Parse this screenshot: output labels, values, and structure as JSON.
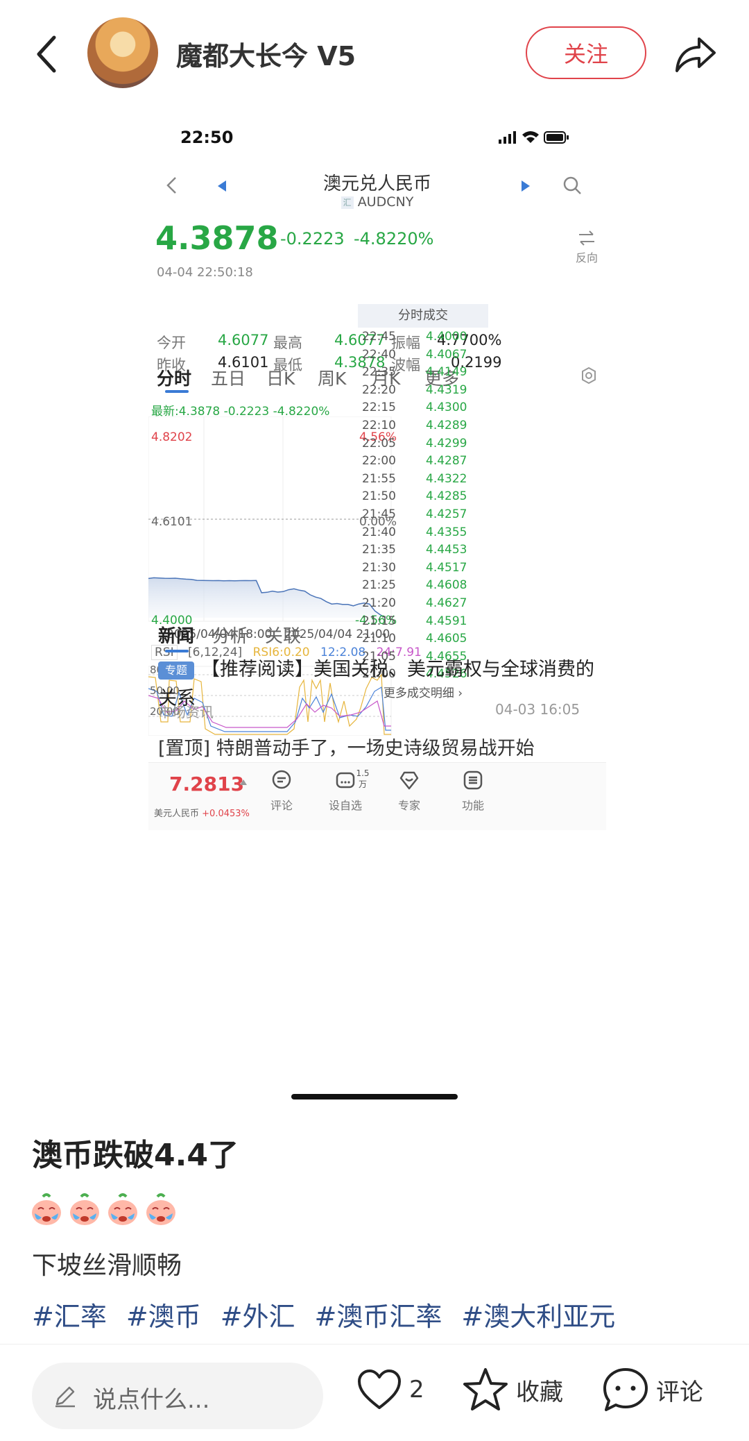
{
  "header": {
    "author_name": "魔都大长今 V5",
    "follow_label": "关注"
  },
  "screenshot": {
    "status_time": "22:50",
    "pair_name": "澳元兑人民币",
    "pair_code": "AUDCNY",
    "pair_icon_text": "汇",
    "price": "4.3878",
    "change": "-0.2223",
    "change_pct": "-4.8220%",
    "timestamp": "04-04 22:50:18",
    "reverse_label": "反向",
    "stats": {
      "open_label": "今开",
      "open": "4.6077",
      "high_label": "最高",
      "high": "4.6077",
      "amplitude_label": "振幅",
      "amplitude": "4.7700%",
      "prev_close_label": "昨收",
      "prev_close": "4.6101",
      "low_label": "最低",
      "low": "4.3878",
      "range_label": "波幅",
      "range": "0.2199"
    },
    "tabs": [
      "分时",
      "五日",
      "日K",
      "周K",
      "月K",
      "更多"
    ],
    "latest_line": "最新:4.3878  -0.2223  -4.8220%",
    "chart_labels": {
      "y_top": "4.8202",
      "y_top_pct": "4.56%",
      "y_mid": "4.6101",
      "y_mid_pct": "0.00%",
      "y_bottom": "4.4000",
      "y_bottom_pct": "-4.56%",
      "x_left": "2025/04/04 18:00",
      "x_right": "2025/04/04 21:00"
    },
    "trades_header": "分时成交",
    "trades": [
      {
        "time": "22:45",
        "price": "4.4000"
      },
      {
        "time": "22:40",
        "price": "4.4067"
      },
      {
        "time": "22:35",
        "price": "4.4149"
      },
      {
        "time": "22:20",
        "price": "4.4319"
      },
      {
        "time": "22:15",
        "price": "4.4300"
      },
      {
        "time": "22:10",
        "price": "4.4289"
      },
      {
        "time": "22:05",
        "price": "4.4299"
      },
      {
        "time": "22:00",
        "price": "4.4287"
      },
      {
        "time": "21:55",
        "price": "4.4322"
      },
      {
        "time": "21:50",
        "price": "4.4285"
      },
      {
        "time": "21:45",
        "price": "4.4257"
      },
      {
        "time": "21:40",
        "price": "4.4355"
      },
      {
        "time": "21:35",
        "price": "4.4453"
      },
      {
        "time": "21:30",
        "price": "4.4517"
      },
      {
        "time": "21:25",
        "price": "4.4608"
      },
      {
        "time": "21:20",
        "price": "4.4627"
      },
      {
        "time": "21:15",
        "price": "4.4591"
      },
      {
        "time": "21:10",
        "price": "4.4605"
      },
      {
        "time": "21:05",
        "price": "4.4655"
      },
      {
        "time": "21:00",
        "price": "4.4526"
      }
    ],
    "more_trades": "更多成交明细 ›",
    "rsi": {
      "label": "RSI",
      "params": "[6,12,24]",
      "rsi6": "RSI6:0.20",
      "rsi12": "12:2.08",
      "rsi24": "24:7.91",
      "y_labels": [
        "80.00",
        "50.00",
        "20.00"
      ]
    },
    "news_tabs": [
      "新闻",
      "分析",
      "关联"
    ],
    "news": [
      {
        "tag": "专题",
        "title": "【推荐阅读】美国关税、美元霸权与全球消费的关系",
        "source": "市场资讯",
        "time": "04-03 16:05"
      },
      {
        "title": "[置顶] 特朗普动手了，一场史诗级贸易战开始"
      }
    ],
    "bottom_bar": {
      "usd_price": "7.2813",
      "usd_name": "美元人民币",
      "usd_pct": "+0.0453%",
      "comment_label": "评论",
      "watch_label": "设自选",
      "watch_badge": "1.5万",
      "expert_label": "专家",
      "func_label": "功能"
    },
    "colors": {
      "down": "#28a745",
      "up": "#e0434a",
      "accent": "#3a7bd5"
    }
  },
  "chart_data": {
    "type": "line",
    "title": "澳元兑人民币 AUDCNY",
    "xlabel": "",
    "ylabel": "",
    "x_ticks": [
      "2025/04/04 18:00",
      "2025/04/04 21:00"
    ],
    "ylim": [
      4.4,
      4.8202
    ],
    "reference_line": 4.6101,
    "series": [
      {
        "name": "",
        "values": [
          4.4855,
          4.487,
          4.4865,
          4.486,
          4.4858,
          4.4862,
          4.485,
          4.484,
          4.4835,
          4.4815,
          4.4812,
          4.481,
          4.4808,
          4.481,
          4.4805,
          4.4808,
          4.4806,
          4.4808,
          4.481,
          4.4808,
          4.4812,
          4.4545,
          4.4555,
          4.458,
          4.456,
          4.457,
          4.461,
          4.463,
          4.46,
          4.458,
          4.45,
          4.445,
          4.442,
          4.435,
          4.43,
          4.431,
          4.429,
          4.429,
          4.426,
          4.43,
          4.432,
          4.43,
          4.415,
          4.4067,
          4.4
        ]
      }
    ]
  },
  "post": {
    "title": "澳币跌破4.4了",
    "emoji_count": 4,
    "body": "下坡丝滑顺畅",
    "hashtags": [
      "#汇率",
      "#澳币",
      "#外汇",
      "#澳币汇率",
      "#澳大利亚元"
    ]
  },
  "bottom_bar": {
    "comment_placeholder": "说点什么...",
    "like_count": "2",
    "collect_label": "收藏",
    "comment_label": "评论"
  }
}
